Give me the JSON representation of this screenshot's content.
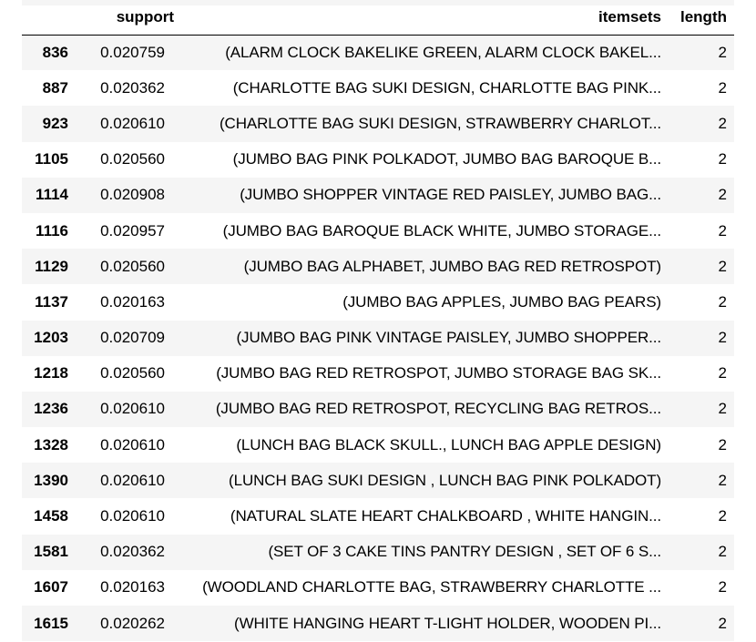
{
  "table": {
    "columns": {
      "index": "",
      "support": "support",
      "itemsets": "itemsets",
      "length": "length"
    },
    "rows": [
      {
        "index": "836",
        "support": "0.020759",
        "itemsets": "(ALARM CLOCK BAKELIKE GREEN, ALARM CLOCK BAKEL...",
        "length": "2"
      },
      {
        "index": "887",
        "support": "0.020362",
        "itemsets": "(CHARLOTTE BAG SUKI DESIGN, CHARLOTTE BAG PINK...",
        "length": "2"
      },
      {
        "index": "923",
        "support": "0.020610",
        "itemsets": "(CHARLOTTE BAG SUKI DESIGN, STRAWBERRY CHARLOT...",
        "length": "2"
      },
      {
        "index": "1105",
        "support": "0.020560",
        "itemsets": "(JUMBO BAG PINK POLKADOT, JUMBO BAG BAROQUE B...",
        "length": "2"
      },
      {
        "index": "1114",
        "support": "0.020908",
        "itemsets": "(JUMBO SHOPPER VINTAGE RED PAISLEY, JUMBO BAG...",
        "length": "2"
      },
      {
        "index": "1116",
        "support": "0.020957",
        "itemsets": "(JUMBO BAG BAROQUE BLACK WHITE, JUMBO STORAGE...",
        "length": "2"
      },
      {
        "index": "1129",
        "support": "0.020560",
        "itemsets": "(JUMBO BAG ALPHABET, JUMBO BAG RED RETROSPOT)",
        "length": "2"
      },
      {
        "index": "1137",
        "support": "0.020163",
        "itemsets": "(JUMBO BAG APPLES, JUMBO BAG PEARS)",
        "length": "2"
      },
      {
        "index": "1203",
        "support": "0.020709",
        "itemsets": "(JUMBO BAG PINK VINTAGE PAISLEY, JUMBO SHOPPER...",
        "length": "2"
      },
      {
        "index": "1218",
        "support": "0.020560",
        "itemsets": "(JUMBO BAG RED RETROSPOT, JUMBO STORAGE BAG SK...",
        "length": "2"
      },
      {
        "index": "1236",
        "support": "0.020610",
        "itemsets": "(JUMBO BAG RED RETROSPOT, RECYCLING BAG RETROS...",
        "length": "2"
      },
      {
        "index": "1328",
        "support": "0.020610",
        "itemsets": "(LUNCH BAG BLACK SKULL., LUNCH BAG APPLE DESIGN)",
        "length": "2"
      },
      {
        "index": "1390",
        "support": "0.020610",
        "itemsets": "(LUNCH BAG SUKI DESIGN , LUNCH BAG PINK POLKADOT)",
        "length": "2"
      },
      {
        "index": "1458",
        "support": "0.020610",
        "itemsets": "(NATURAL SLATE HEART CHALKBOARD , WHITE HANGIN...",
        "length": "2"
      },
      {
        "index": "1581",
        "support": "0.020362",
        "itemsets": "(SET OF 3 CAKE TINS PANTRY DESIGN , SET OF 6 S...",
        "length": "2"
      },
      {
        "index": "1607",
        "support": "0.020163",
        "itemsets": "(WOODLAND CHARLOTTE BAG, STRAWBERRY CHARLOTTE ...",
        "length": "2"
      },
      {
        "index": "1615",
        "support": "0.020262",
        "itemsets": "(WHITE HANGING HEART T-LIGHT HOLDER, WOODEN PI...",
        "length": "2"
      }
    ]
  },
  "colors": {
    "stripe": "#f5f5f5",
    "background": "#ffffff",
    "text": "#000000"
  }
}
